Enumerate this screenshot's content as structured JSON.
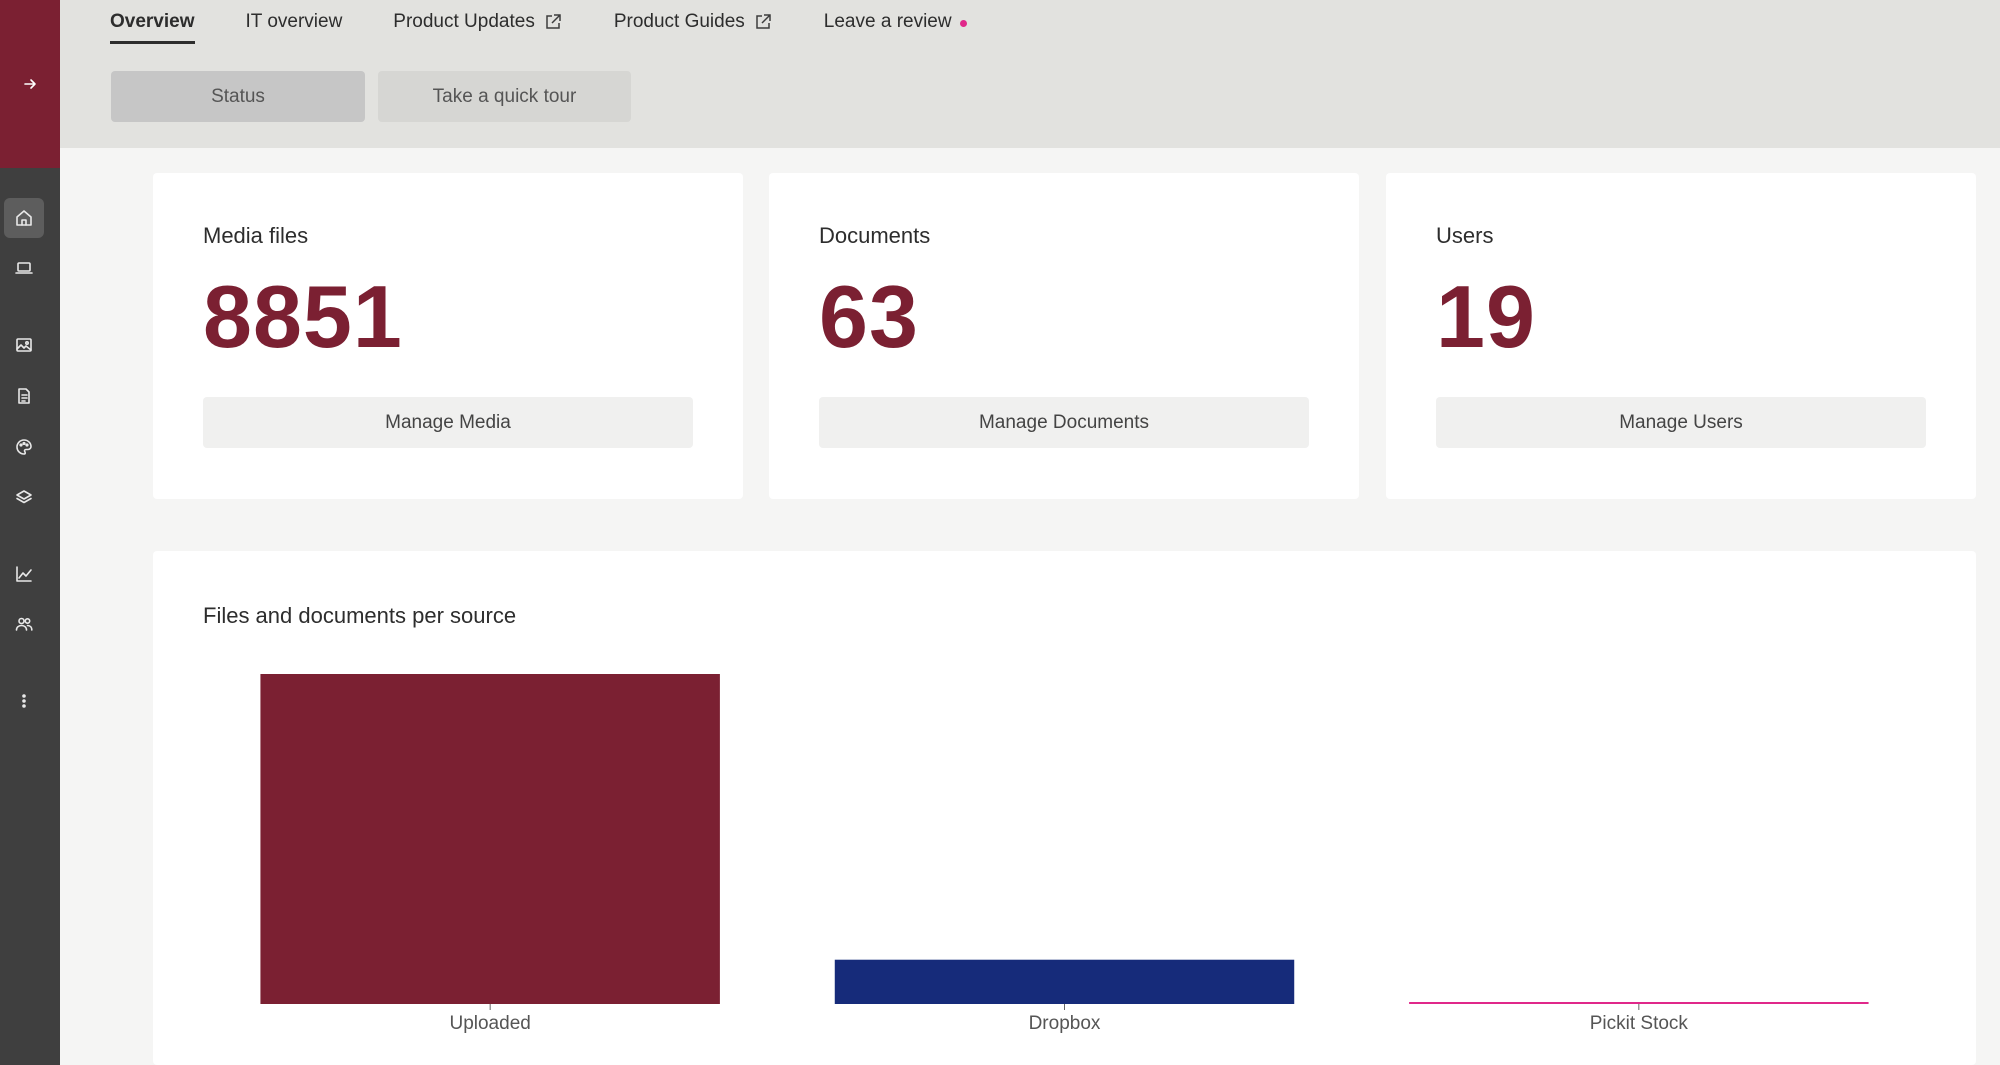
{
  "sidebar": {
    "items": [
      {
        "name": "home-icon",
        "active": true
      },
      {
        "name": "laptop-icon",
        "active": false
      },
      {
        "name": "image-icon",
        "active": false
      },
      {
        "name": "document-icon",
        "active": false
      },
      {
        "name": "palette-icon",
        "active": false
      },
      {
        "name": "layers-icon",
        "active": false
      },
      {
        "name": "chart-line-icon",
        "active": false
      },
      {
        "name": "users-icon",
        "active": false
      },
      {
        "name": "more-vertical-icon",
        "active": false
      }
    ],
    "expand_icon": "arrow-right-icon",
    "brand_color": "#7b2032"
  },
  "header": {
    "tabs": [
      {
        "label": "Overview",
        "active": true
      },
      {
        "label": "IT overview"
      },
      {
        "label": "Product Updates",
        "external": true
      },
      {
        "label": "Product Guides",
        "external": true
      },
      {
        "label": "Leave a review",
        "badge_dot": true
      }
    ],
    "status_button": "Status",
    "tour_button": "Take a quick tour"
  },
  "stats": {
    "media": {
      "title": "Media files",
      "value": "8851",
      "button": "Manage Media"
    },
    "documents": {
      "title": "Documents",
      "value": "63",
      "button": "Manage Documents"
    },
    "users": {
      "title": "Users",
      "value": "19",
      "button": "Manage Users"
    }
  },
  "chart": {
    "title": "Files and documents per source"
  },
  "chart_data": {
    "type": "bar",
    "title": "Files and documents per source",
    "categories": [
      "Uploaded",
      "Dropbox",
      "Pickit Stock"
    ],
    "values": [
      8792,
      1180,
      42
    ],
    "colors": [
      "#7b2032",
      "#162b7a",
      "#e0288a"
    ],
    "xlabel": "",
    "ylabel": "",
    "ylim": [
      0,
      8792
    ],
    "grid": false,
    "legend": "none"
  },
  "colors": {
    "accent": "#7b2032",
    "dropbox": "#162b7a",
    "pickit": "#e0288a"
  }
}
